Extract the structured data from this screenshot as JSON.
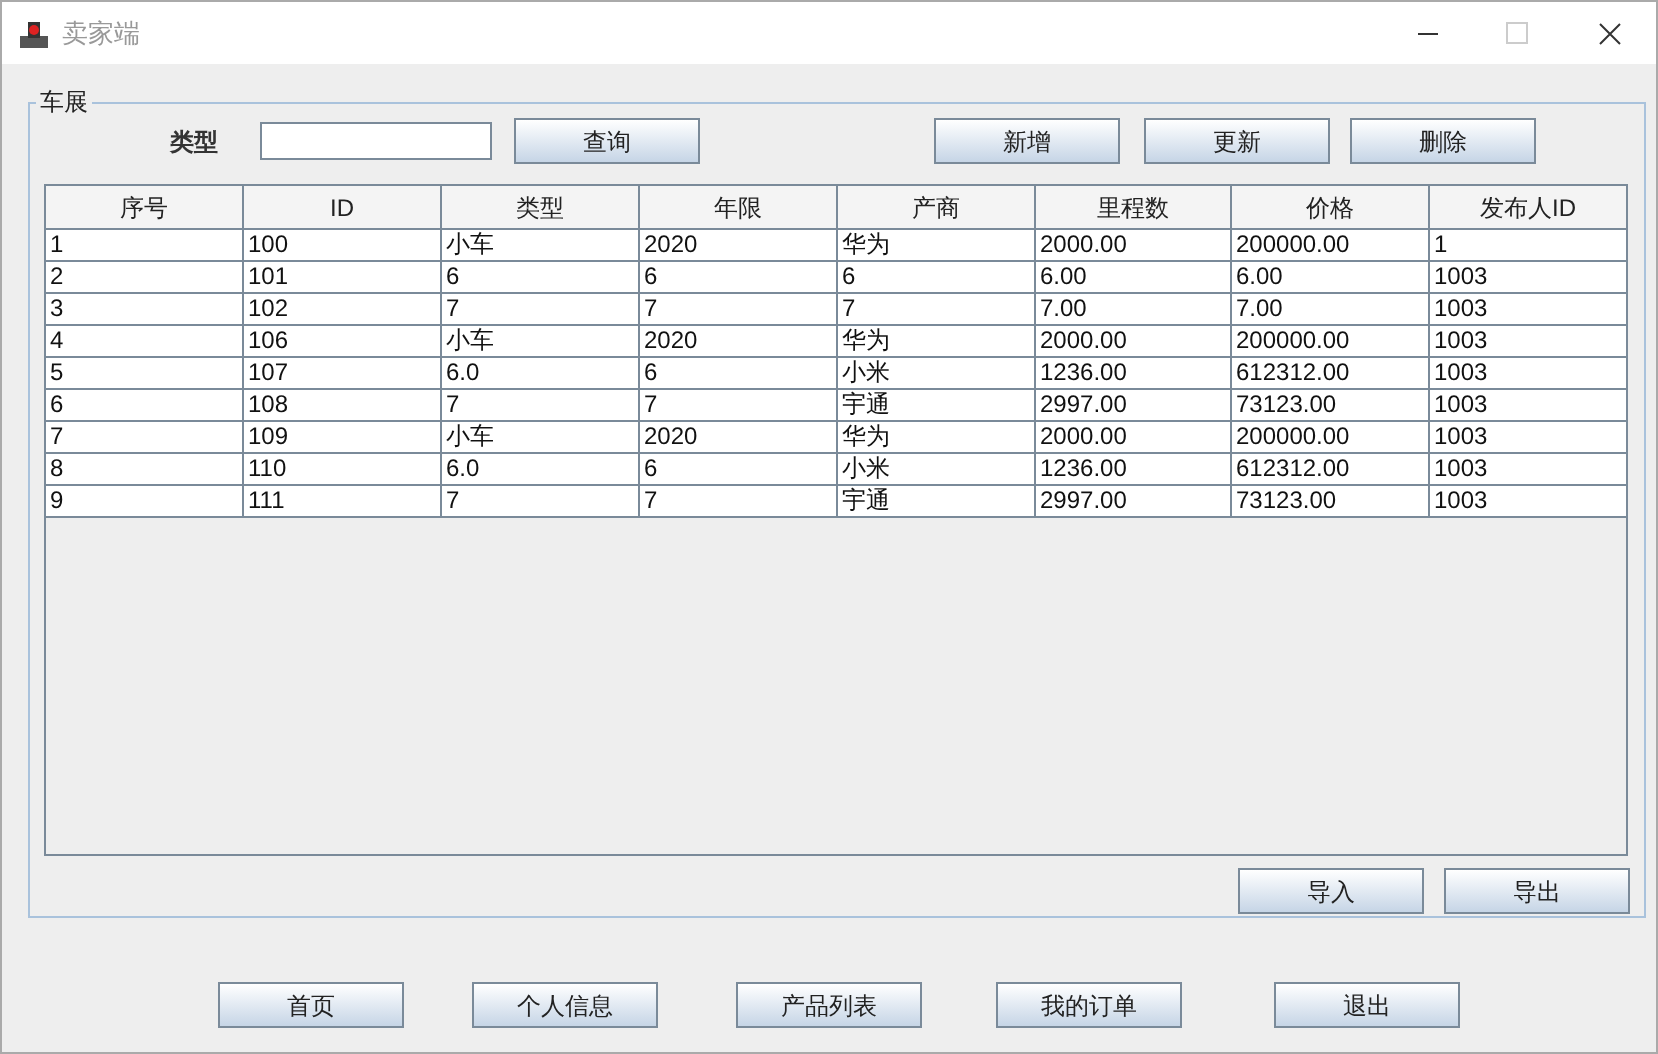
{
  "window": {
    "title": "卖家端"
  },
  "panel": {
    "title": "车展"
  },
  "search": {
    "label": "类型",
    "button": "查询"
  },
  "actions": [
    "新增",
    "更新",
    "删除"
  ],
  "table": {
    "columns": [
      "序号",
      "ID",
      "类型",
      "年限",
      "产商",
      "里程数",
      "价格",
      "发布人ID"
    ],
    "rows": [
      [
        "1",
        "100",
        "小车",
        "2020",
        "华为",
        "2000.00",
        "200000.00",
        "1"
      ],
      [
        "2",
        "101",
        "6",
        "6",
        "6",
        "6.00",
        "6.00",
        "1003"
      ],
      [
        "3",
        "102",
        "7",
        "7",
        "7",
        "7.00",
        "7.00",
        "1003"
      ],
      [
        "4",
        "106",
        "小车",
        "2020",
        "华为",
        "2000.00",
        "200000.00",
        "1003"
      ],
      [
        "5",
        "107",
        "6.0",
        "6",
        "小米",
        "1236.00",
        "612312.00",
        "1003"
      ],
      [
        "6",
        "108",
        "7",
        "7",
        "宇通",
        "2997.00",
        "73123.00",
        "1003"
      ],
      [
        "7",
        "109",
        "小车",
        "2020",
        "华为",
        "2000.00",
        "200000.00",
        "1003"
      ],
      [
        "8",
        "110",
        "6.0",
        "6",
        "小米",
        "1236.00",
        "612312.00",
        "1003"
      ],
      [
        "9",
        "111",
        "7",
        "7",
        "宇通",
        "2997.00",
        "73123.00",
        "1003"
      ]
    ]
  },
  "io_buttons": [
    "导入",
    "导出"
  ],
  "nav": [
    "首页",
    "个人信息",
    "产品列表",
    "我的订单",
    "退出"
  ]
}
